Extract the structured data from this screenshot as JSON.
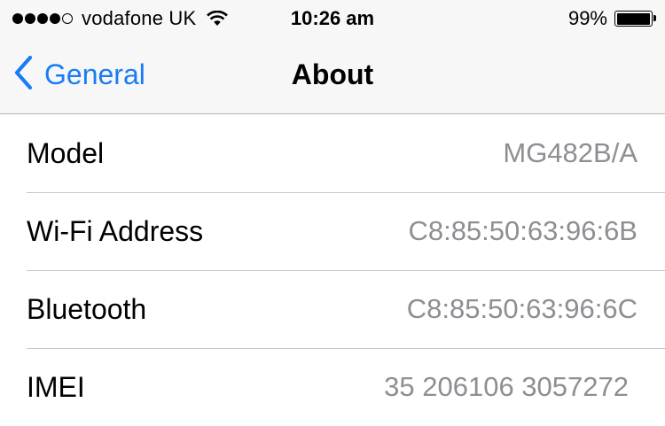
{
  "status_bar": {
    "signal_bars_filled": 4,
    "signal_bars_total": 5,
    "carrier": "vodafone UK",
    "wifi_icon": "wifi-icon",
    "time": "10:26 am",
    "battery_percent": "99%",
    "battery_level": 0.99
  },
  "nav_bar": {
    "back_icon": "chevron-left-icon",
    "back_label": "General",
    "title": "About"
  },
  "rows": [
    {
      "label": "Model",
      "value": "MG482B/A"
    },
    {
      "label": "Wi-Fi Address",
      "value": "C8:85:50:63:96:6B"
    },
    {
      "label": "Bluetooth",
      "value": "C8:85:50:63:96:6C"
    },
    {
      "label": "IMEI",
      "value": "35 206106 3057272"
    }
  ],
  "colors": {
    "accent": "#1a7cf5",
    "value_text": "#8e8e93",
    "background": "#efeff4"
  }
}
